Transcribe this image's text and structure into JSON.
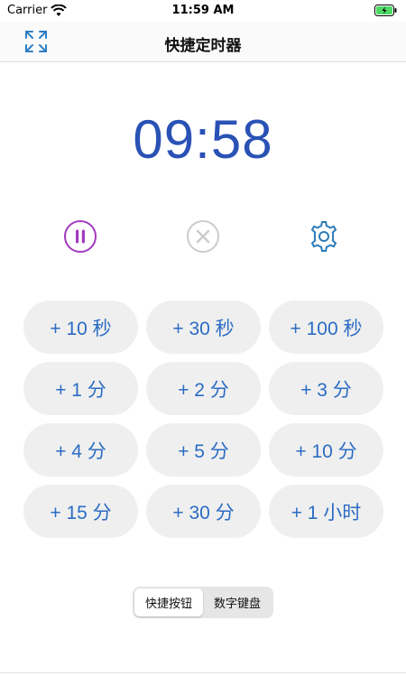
{
  "status_bar": {
    "carrier": "Carrier",
    "time": "11:59 AM"
  },
  "nav": {
    "title": "快捷定时器"
  },
  "timer": {
    "display": "09:58"
  },
  "colors": {
    "accent_blue": "#2a52b5",
    "button_text": "#2b6cc4",
    "pause_purple": "#a23bbf",
    "disabled_gray": "#cccccc",
    "settings_teal": "#2d7bb8"
  },
  "quick_buttons": [
    {
      "label": "+ 10 秒"
    },
    {
      "label": "+ 30 秒"
    },
    {
      "label": "+ 100 秒"
    },
    {
      "label": "+ 1 分"
    },
    {
      "label": "+ 2 分"
    },
    {
      "label": "+ 3 分"
    },
    {
      "label": "+ 4 分"
    },
    {
      "label": "+ 5 分"
    },
    {
      "label": "+ 10 分"
    },
    {
      "label": "+ 15 分"
    },
    {
      "label": "+ 30 分"
    },
    {
      "label": "+ 1 小时"
    }
  ],
  "mode_segment": {
    "options": [
      "快捷按钮",
      "数字键盘"
    ],
    "selected": "快捷按钮"
  }
}
